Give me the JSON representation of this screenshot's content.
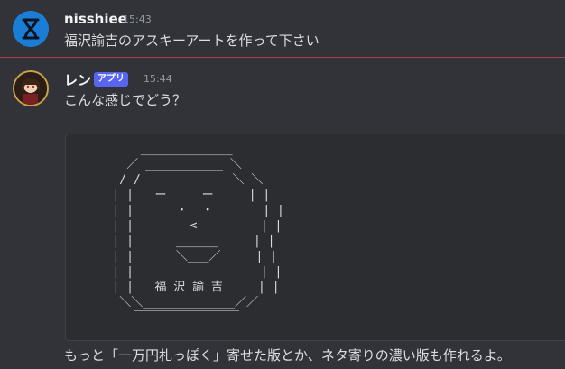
{
  "messages": [
    {
      "author": "nisshiee",
      "time": "15:43",
      "text": "福沢諭吉のアスキーアートを作って下さい",
      "avatar_icon": "hourglass-logo-icon",
      "avatar_color": "#1b7ed6"
    },
    {
      "author": "レン",
      "badge": "アプリ",
      "time": "15:44",
      "text": "こんな感じでどう？",
      "avatar_icon": "anime-character-avatar",
      "code": "       _____________\n     ／ ___________ ＼\n    / /             ＼ ＼\n   | |   ー     ー     | |\n   | |      ・  ・       | |\n   | |        <         | |\n   | |      ______     | |\n   | |      ＼___／     | |\n   | |                  | |\n   | |   福 沢 諭 吉     | |\n    ＼＼_____________／／\n      ￣￣￣￣￣￣￣￣￣",
      "followup": "もっと「一万円札っぽく」寄せた版とか、ネタ寄りの濃い版も作れるよ。"
    }
  ],
  "colors": {
    "background": "#313338",
    "code_bg": "#2b2d31",
    "badge": "#5865f2",
    "divider": "#a3404a"
  }
}
